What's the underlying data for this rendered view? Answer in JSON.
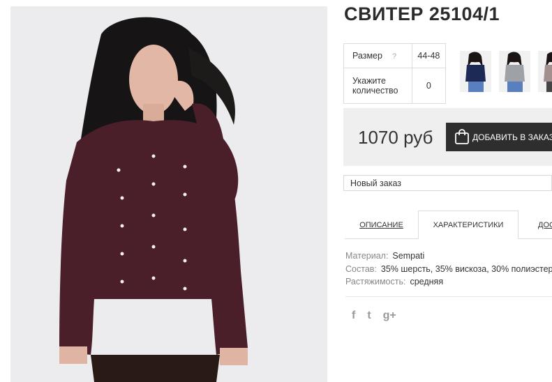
{
  "product": {
    "title": "СВИТЕР 25104/1",
    "price": "1070 руб",
    "add_to_cart_label": "ДОБАВИТЬ В ЗАКАЗ"
  },
  "options": {
    "size_label": "Размер",
    "size_help": "?",
    "size_value": "44-48",
    "qty_label": "Укажите количество",
    "qty_value": "0"
  },
  "order": {
    "selected": "Новый заказ"
  },
  "tabs": [
    {
      "label": "ОПИСАНИЕ"
    },
    {
      "label": "ХАРАКТЕРИСТИКИ"
    },
    {
      "label": "ДОСТАВКА"
    }
  ],
  "specs": [
    {
      "key": "Материал:",
      "value": "Sempati"
    },
    {
      "key": "Состав:",
      "value": "35% шерсть, 35% вискоза, 30% полиэстер"
    },
    {
      "key": "Растяжимость:",
      "value": "средняя"
    }
  ],
  "social": [
    {
      "icon": "facebook-icon",
      "glyph": "f"
    },
    {
      "icon": "twitter-icon",
      "glyph": "t"
    },
    {
      "icon": "google-plus-icon",
      "glyph": "g+"
    }
  ],
  "colors": {
    "sweater": "#4a1f2a",
    "button": "#2e2e2e",
    "pricebar": "#efefef"
  }
}
